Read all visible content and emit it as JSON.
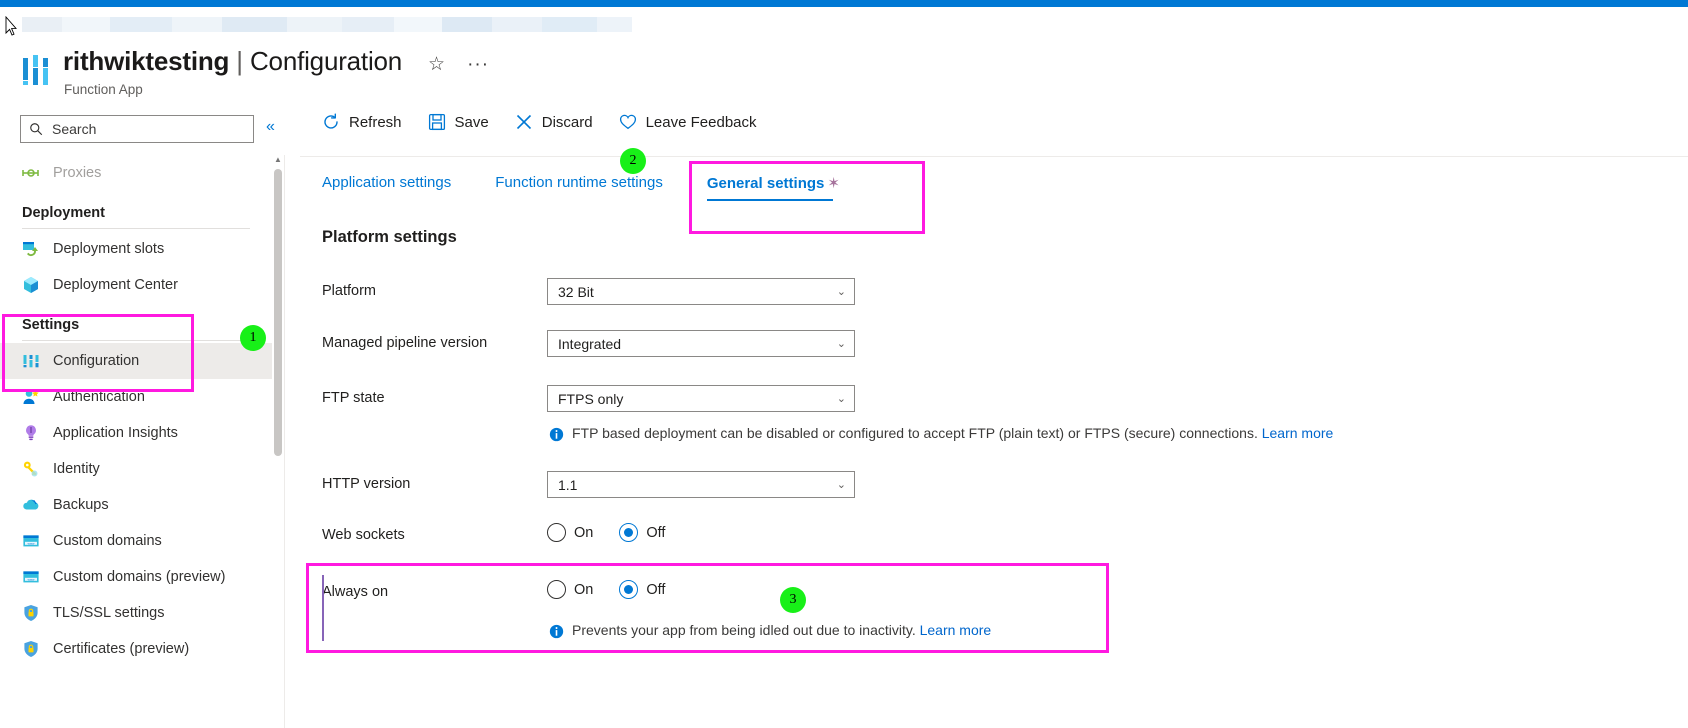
{
  "window": {
    "accent_color": "#0078d4",
    "highlight_color": "#ff19e0",
    "badge_color": "#18f018"
  },
  "header": {
    "resource_name": "rithwiktesting",
    "separator": "|",
    "page_name": "Configuration",
    "resource_type": "Function App",
    "favorite_icon": "star-icon",
    "more_icon": "ellipsis-icon"
  },
  "search": {
    "placeholder": "Search",
    "value": "",
    "icon": "search-icon",
    "collapse_icon": "chevron-double-left-icon"
  },
  "sidebar": {
    "items": [
      {
        "label": "Proxies",
        "icon": "proxies-icon",
        "type": "item",
        "state": "disabled"
      },
      {
        "label": "Deployment",
        "type": "group"
      },
      {
        "label": "Deployment slots",
        "icon": "deployment-slots-icon",
        "type": "item",
        "state": "normal"
      },
      {
        "label": "Deployment Center",
        "icon": "deployment-center-icon",
        "type": "item",
        "state": "normal"
      },
      {
        "label": "Settings",
        "type": "group"
      },
      {
        "label": "Configuration",
        "icon": "configuration-icon",
        "type": "item",
        "state": "selected"
      },
      {
        "label": "Authentication",
        "icon": "authentication-icon",
        "type": "item",
        "state": "normal"
      },
      {
        "label": "Application Insights",
        "icon": "application-insights-icon",
        "type": "item",
        "state": "normal"
      },
      {
        "label": "Identity",
        "icon": "identity-key-icon",
        "type": "item",
        "state": "normal"
      },
      {
        "label": "Backups",
        "icon": "backups-cloud-icon",
        "type": "item",
        "state": "normal"
      },
      {
        "label": "Custom domains",
        "icon": "custom-domains-icon",
        "type": "item",
        "state": "normal"
      },
      {
        "label": "Custom domains (preview)",
        "icon": "custom-domains-icon",
        "type": "item",
        "state": "normal"
      },
      {
        "label": "TLS/SSL settings",
        "icon": "shield-lock-icon",
        "type": "item",
        "state": "normal"
      },
      {
        "label": "Certificates (preview)",
        "icon": "shield-lock-icon",
        "type": "item",
        "state": "normal"
      }
    ]
  },
  "toolbar": {
    "buttons": [
      {
        "label": "Refresh",
        "icon": "refresh-icon"
      },
      {
        "label": "Save",
        "icon": "save-disk-icon"
      },
      {
        "label": "Discard",
        "icon": "close-x-icon"
      },
      {
        "label": "Leave Feedback",
        "icon": "heart-icon"
      }
    ]
  },
  "tabs": [
    {
      "label": "Application settings",
      "active": false,
      "modified": false
    },
    {
      "label": "Function runtime settings",
      "active": false,
      "modified": false
    },
    {
      "label": "General settings",
      "active": true,
      "modified": true,
      "modified_marker": "✶"
    }
  ],
  "main": {
    "section_title": "Platform settings",
    "fields": [
      {
        "label": "Platform",
        "control": "dropdown",
        "value": "32 Bit",
        "chevron": "chevron-down-icon"
      },
      {
        "label": "Managed pipeline version",
        "control": "dropdown",
        "value": "Integrated",
        "chevron": "chevron-down-icon"
      },
      {
        "label": "FTP state",
        "control": "dropdown",
        "value": "FTPS only",
        "chevron": "chevron-down-icon",
        "hint": "FTP based deployment can be disabled or configured to accept FTP (plain text) or FTPS (secure) connections.",
        "hint_link": "Learn more",
        "hint_icon": "info-icon"
      },
      {
        "label": "HTTP version",
        "control": "dropdown",
        "value": "1.1",
        "chevron": "chevron-down-icon"
      },
      {
        "label": "Web sockets",
        "control": "radio",
        "options": [
          "On",
          "Off"
        ],
        "selected": "Off"
      },
      {
        "label": "Always on",
        "control": "radio",
        "options": [
          "On",
          "Off"
        ],
        "selected": "Off",
        "hint": "Prevents your app from being idled out due to inactivity.",
        "hint_link": "Learn more",
        "hint_icon": "info-icon"
      }
    ]
  },
  "annotations": {
    "steps": [
      {
        "number": "1",
        "target": "sidebar-settings-configuration"
      },
      {
        "number": "2",
        "target": "tab-general-settings"
      },
      {
        "number": "3",
        "target": "field-always-on"
      }
    ]
  }
}
